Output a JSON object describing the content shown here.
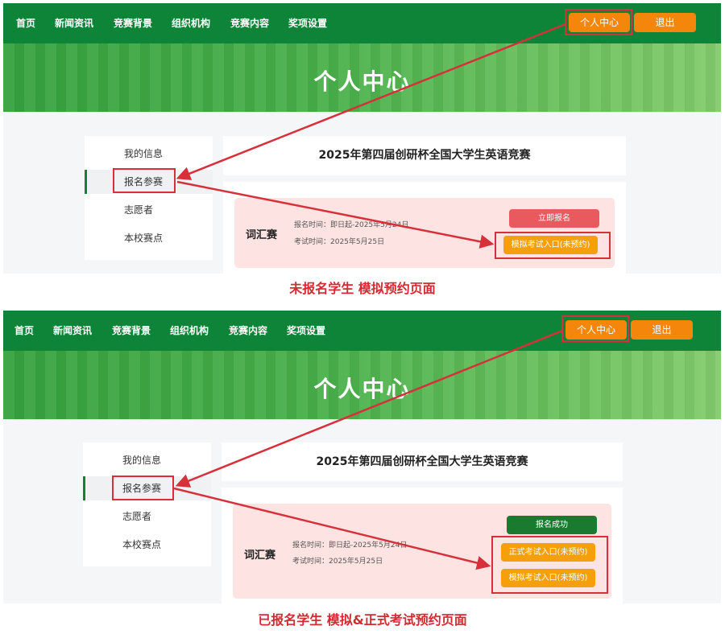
{
  "nav": {
    "links": [
      "首页",
      "新闻资讯",
      "竞赛背景",
      "组织机构",
      "竞赛内容",
      "奖项设置"
    ],
    "personal_center_label": "个人中心",
    "logout_label": "退出"
  },
  "banner": {
    "title": "个人中心"
  },
  "sidebar": {
    "items": [
      "我的信息",
      "报名参赛",
      "志愿者",
      "本校赛点"
    ]
  },
  "contest_title": "2025年第四届创研杯全国大学生英语竞赛",
  "contest": {
    "name": "词汇赛",
    "registration_time": "报名时间：即日起-2025年5月24日",
    "exam_time": "考试时间：2025年5月25日"
  },
  "panel_unregistered": {
    "register_button": "立即报名",
    "mock_exam_button": "模拟考试入口(未预约)",
    "caption": "未报名学生  模拟预约页面"
  },
  "panel_registered": {
    "status_button": "报名成功",
    "formal_exam_button": "正式考试入口(未预约)",
    "mock_exam_button": "模拟考试入口(未预约)",
    "caption": "已报名学生  模拟&正式考试预约页面"
  },
  "colors": {
    "nav_green": "#0d8437",
    "accent_orange": "#f5860c",
    "annotation_red": "#d6303a",
    "register_red": "#e95a5f",
    "success_green": "#1a7a2f"
  }
}
